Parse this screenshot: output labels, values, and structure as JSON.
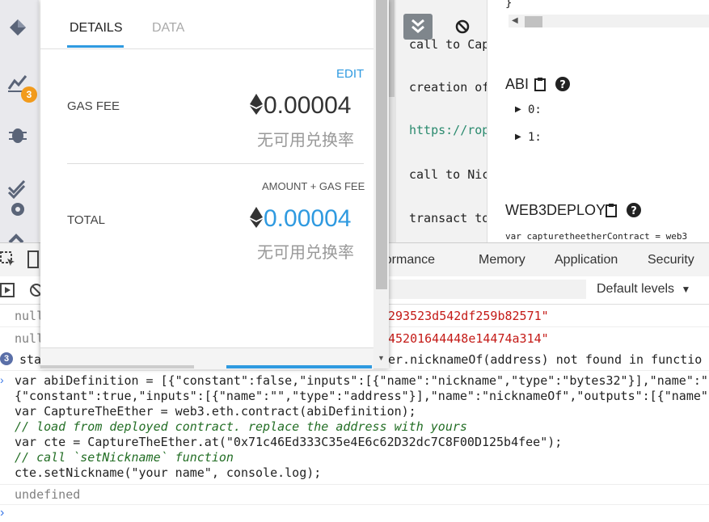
{
  "popup": {
    "tabs": [
      "DETAILS",
      "DATA"
    ],
    "edit_label": "EDIT",
    "gas_fee_label": "GAS FEE",
    "gas_fee_value": "0.00004",
    "gas_fee_sub": "无可用兑换率",
    "amount_gas_fee_label": "AMOUNT + GAS FEE",
    "total_label": "TOTAL",
    "total_value": "0.00004",
    "total_sub": "无可用兑换率"
  },
  "editor": {
    "lines": [
      "call to Cap",
      "creation of",
      "https://rop",
      "call to Nic",
      "transact to"
    ]
  },
  "right_panel": {
    "brace": "}",
    "abi_label": "ABI",
    "abi_items": [
      "0:",
      "1:"
    ],
    "web3deploy_label": "WEB3DEPLOY",
    "deploy_code": "var capturetheetherContract = web3"
  },
  "sidebar": {
    "badge_count": "3"
  },
  "devtools": {
    "tabs": [
      "Performance",
      "Memory",
      "Application",
      "Security"
    ],
    "tab_first_visible": "rformance",
    "levels_label": "Default levels"
  },
  "console": {
    "rows": [
      {
        "left": "null",
        "right": "293523d542df259b82571\""
      },
      {
        "left": "null",
        "right": "45201644448e14474a314\""
      }
    ],
    "warn_badge": "3",
    "warn_left": "sta",
    "warn_right": "er.nicknameOf(address) not found in functio",
    "code_lines": [
      "var abiDefinition = [{\"constant\":false,\"inputs\":[{\"name\":\"nickname\",\"type\":\"bytes32\"}],\"name\":\"",
      "{\"constant\":true,\"inputs\":[{\"name\":\"\",\"type\":\"address\"}],\"name\":\"nicknameOf\",\"outputs\":[{\"name\"",
      "var CaptureTheEther = web3.eth.contract(abiDefinition);",
      "// load from deployed contract. replace the address with yours",
      "var cte = CaptureTheEther.at(\"0x71c46Ed333C35e4E6c62D32dc7C8F00D125b4fee\");",
      "// call `setNickname` function",
      "cte.setNickname(\"your name\", console.log);"
    ],
    "result": "undefined"
  },
  "colors": {
    "accent": "#2f9ae0",
    "string_red": "#c41a16",
    "keyword_purple": "#aa0d91",
    "comment_green": "#236e25",
    "badge_orange": "#f29b1c"
  }
}
